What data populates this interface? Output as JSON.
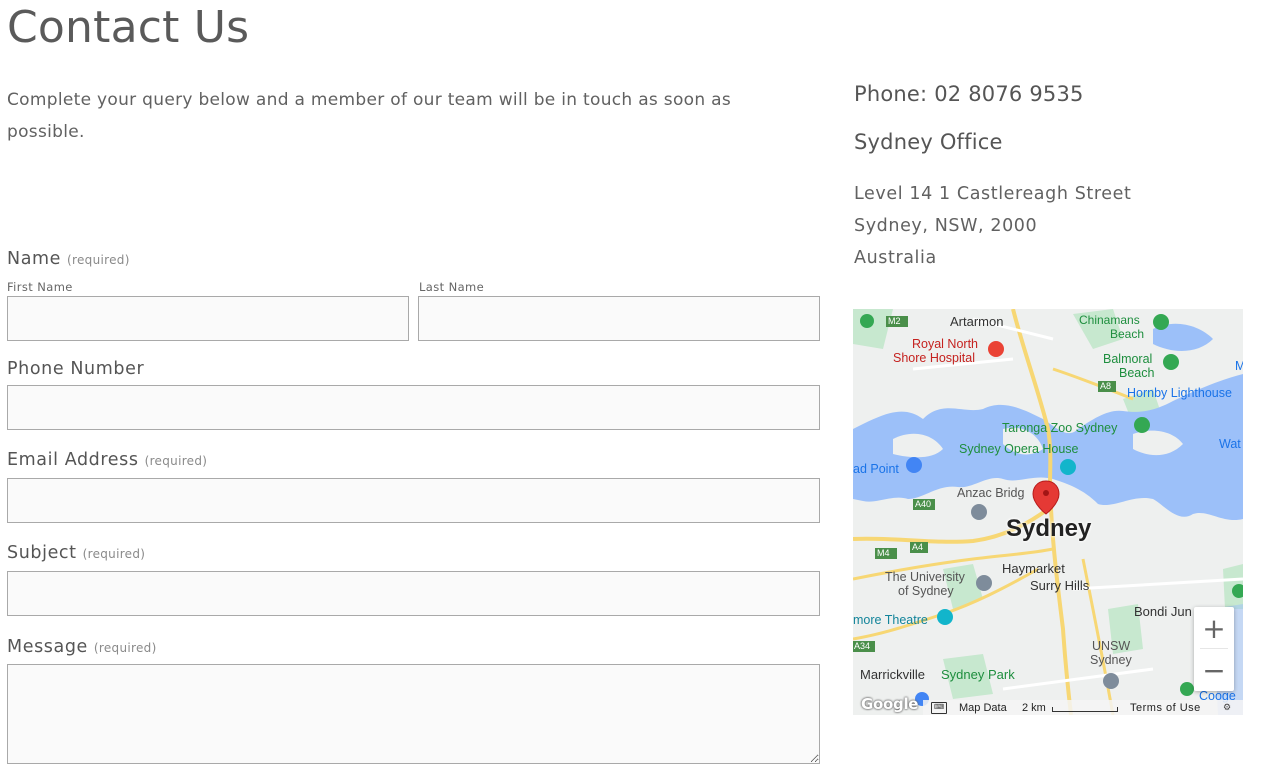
{
  "page": {
    "title": "Contact Us",
    "intro": "Complete your query below and a member of our team will be in touch as soon as possible."
  },
  "form": {
    "name_label": "Name",
    "name_required": "(required)",
    "first_name_label": "First Name",
    "last_name_label": "Last Name",
    "phone_label": "Phone Number",
    "email_label": "Email Address",
    "email_required": "(required)",
    "subject_label": "Subject",
    "subject_required": "(required)",
    "message_label": "Message",
    "message_required": "(required)",
    "first_name_value": "",
    "last_name_value": "",
    "phone_value": "",
    "email_value": "",
    "subject_value": "",
    "message_value": ""
  },
  "contact": {
    "phone": "Phone: 02 8076 9535",
    "office_title": "Sydney Office",
    "address": [
      "Level 14 1 Castlereagh Street",
      "Sydney, NSW, 2000",
      "Australia"
    ]
  },
  "map": {
    "labels": {
      "artarmon": "Artarmon",
      "chinamans": "Chinamans",
      "chinamans2": "Beach",
      "royal_north": "Royal North",
      "shore_hospital": "Shore Hospital",
      "balmoral": "Balmoral",
      "balmoral2": "Beach",
      "hornby": "Hornby Lighthouse",
      "taronga": "Taronga Zoo Sydney",
      "opera_house": "Sydney Opera House",
      "wat": "Wat",
      "ad_point": "ad Point",
      "anzac": "Anzac Bridg",
      "sydney": "Sydney",
      "haymarket": "Haymarket",
      "surry_hills": "Surry Hills",
      "university": "The University",
      "university2": "of Sydney",
      "bondi": "Bondi Jun",
      "more_theatre": "more Theatre",
      "unsw": "UNSW",
      "unsw2": "Sydney",
      "marrickville": "Marrickville",
      "sydney_park": "Sydney Park",
      "cooge": "Cooge",
      "m": "M"
    },
    "shields": {
      "m2": "M2",
      "a8": "A8",
      "a40": "A40",
      "a4": "A4",
      "m4": "M4",
      "a34": "A34"
    },
    "zoom_in": "+",
    "zoom_out": "−",
    "google": "Google",
    "map_data": "Map Data",
    "scale": "2 km",
    "terms": "Terms of Use",
    "colors": {
      "water": "#9cc0f9",
      "land": "#eef0ef",
      "park": "#c7e8cf",
      "road": "#f7d774",
      "marker": "#e53935"
    }
  }
}
